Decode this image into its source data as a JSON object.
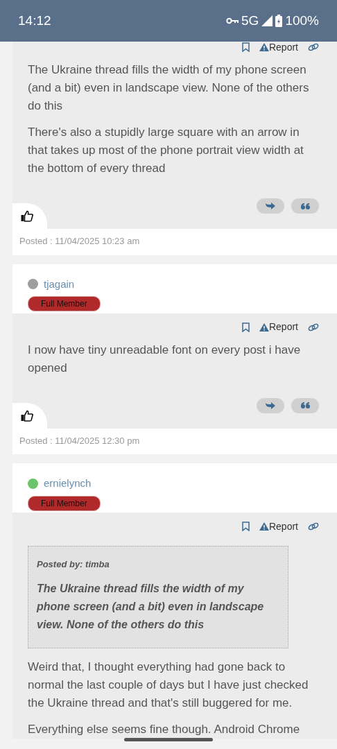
{
  "status_bar": {
    "time": "14:12",
    "network": "5G",
    "battery": "100%"
  },
  "posts": [
    {
      "actions": {
        "report": "Report"
      },
      "paragraphs": [
        "The Ukraine thread fills the width of my phone screen (and a bit) even in landscape view. None of the others do this",
        "There's also a stupidly large square with an arrow in that takes up most of the phone portrait view width at the bottom of every thread"
      ],
      "posted": "Posted : 11/04/2025 10:23 am"
    },
    {
      "author": {
        "name": "tjagain",
        "color": "#9e9e9e",
        "rank": "Full Member"
      },
      "actions": {
        "report": "Report"
      },
      "paragraphs": [
        "I now have tiny unreadable font on every post i have opened"
      ],
      "posted": "Posted : 11/04/2025 12:30 pm"
    },
    {
      "author": {
        "name": "ernielynch",
        "color": "#6cc46a",
        "rank": "Full Member"
      },
      "actions": {
        "report": "Report"
      },
      "quote": {
        "by": "Posted by: timba",
        "text": "The Ukraine thread fills the width of my phone screen (and a bit) even in landscape view. None of the others do this"
      },
      "paragraphs": [
        "Weird that, I thought everything had gone back to normal the last couple of days but I have just checked the Ukraine thread and that's still buggered for me.",
        "Everything else seems fine though. Android Chrome"
      ]
    }
  ]
}
